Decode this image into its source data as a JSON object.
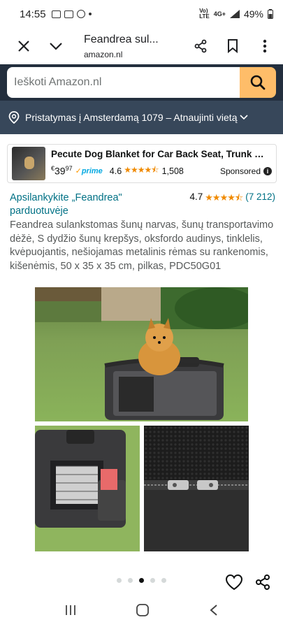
{
  "status_bar": {
    "time": "14:55",
    "network": "4G+",
    "battery": "49%"
  },
  "tab": {
    "title": "Feandrea sul...",
    "url": "amazon.nl"
  },
  "search": {
    "placeholder": "Ieškoti Amazon.nl"
  },
  "delivery": {
    "text": "Pristatymas į Amsterdamą 1079 – Atnaujinti vietą"
  },
  "sponsored": {
    "title": "Pecute Dog Blanket for Car Back Seat, Trunk Blanket,...",
    "price_currency": "€",
    "price_whole": "39",
    "price_fraction": "97",
    "prime": "prime",
    "rating": "4.6",
    "review_count": "1,508",
    "label": "Sponsored"
  },
  "product": {
    "store_link": "Apsilankykite „Feandrea\" parduotuvėje",
    "rating": "4.7",
    "review_count": "(7 212)",
    "title": "Feandrea sulankstomas šunų narvas, šunų transportavimo dėžė, S dydžio šunų krepšys, oksfordo audinys, tinklelis, kvėpuojantis, nešiojamas metalinis rėmas su rankenomis, kišenėmis, 50 x 35 x 35 cm, pilkas, PDC50G01"
  },
  "gallery": {
    "page_count": 5,
    "active_index": 2
  },
  "colors": {
    "amazon_dark": "#232f3e",
    "amazon_bar": "#37475a",
    "search_button": "#febd69",
    "link": "#007185",
    "star": "#f08a00"
  }
}
